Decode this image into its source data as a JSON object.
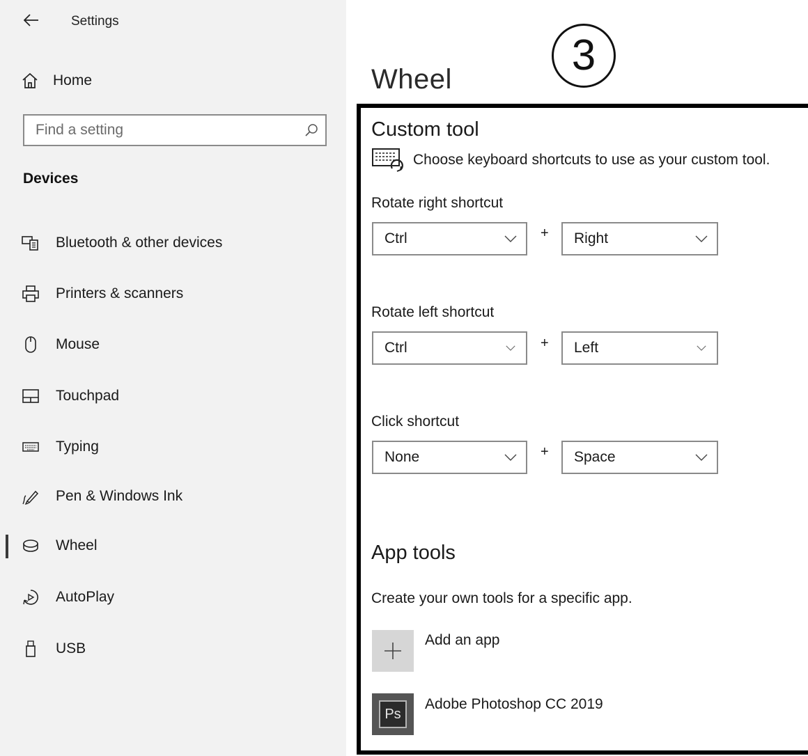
{
  "header": {
    "app_title": "Settings"
  },
  "sidebar": {
    "home_label": "Home",
    "search_placeholder": "Find a setting",
    "section_title": "Devices",
    "items": [
      {
        "label": "Bluetooth & other devices",
        "icon": "bluetooth-devices-icon"
      },
      {
        "label": "Printers & scanners",
        "icon": "printer-icon"
      },
      {
        "label": "Mouse",
        "icon": "mouse-icon"
      },
      {
        "label": "Touchpad",
        "icon": "touchpad-icon"
      },
      {
        "label": "Typing",
        "icon": "keyboard-icon"
      },
      {
        "label": "Pen & Windows Ink",
        "icon": "pen-icon"
      },
      {
        "label": "Wheel",
        "icon": "wheel-icon",
        "selected": true
      },
      {
        "label": "AutoPlay",
        "icon": "autoplay-icon"
      },
      {
        "label": "USB",
        "icon": "usb-icon"
      }
    ]
  },
  "main": {
    "page_title": "Wheel",
    "step_marker": "3",
    "custom_tool": {
      "heading": "Custom tool",
      "description": "Choose keyboard shortcuts to use as your custom tool.",
      "rotate_right": {
        "label": "Rotate right shortcut",
        "modifier": "Ctrl",
        "key": "Right"
      },
      "rotate_left": {
        "label": "Rotate left shortcut",
        "modifier": "Ctrl",
        "key": "Left"
      },
      "click": {
        "label": "Click shortcut",
        "modifier": "None",
        "key": "Space"
      },
      "plus": "+"
    },
    "app_tools": {
      "heading": "App tools",
      "description": "Create your own tools for a specific app.",
      "add_app_label": "Add an app",
      "apps": [
        {
          "label": "Adobe Photoshop CC 2019",
          "icon_text": "Ps"
        }
      ]
    }
  }
}
